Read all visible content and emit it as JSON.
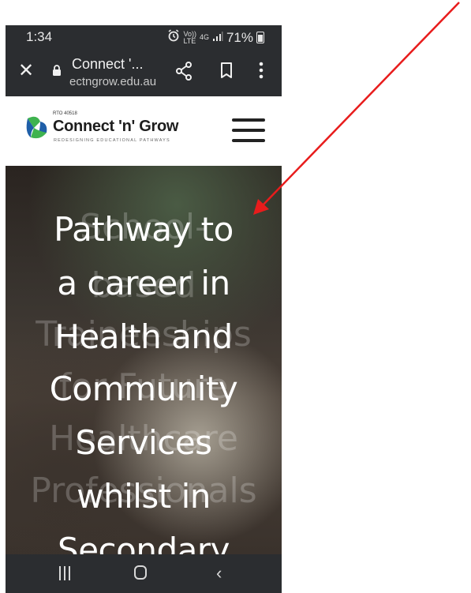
{
  "status_bar": {
    "time": "1:34",
    "volte": "Vo))",
    "lte": "LTE",
    "network": "4G",
    "battery": "71%"
  },
  "browser": {
    "page_title": "Connect '...",
    "url": "ectngrow.edu.au"
  },
  "site": {
    "rto": "RTO 40518",
    "brand": "Connect 'n' Grow",
    "tagline": "REDESIGNING EDUCATIONAL PATHWAYS"
  },
  "hero": {
    "lines": [
      "Pathway to",
      "a career in",
      "Health and",
      "Community",
      "Services",
      "whilst in",
      "Secondary"
    ],
    "background_lines": [
      "School-",
      "based",
      "Traineeships",
      "for Future",
      "Healthcare",
      "Professionals"
    ]
  },
  "colors": {
    "annotation_arrow": "#e81c1c",
    "browser_chrome": "#2b2d30",
    "logo_green": "#3fb34f",
    "logo_blue": "#1f5fa8"
  }
}
